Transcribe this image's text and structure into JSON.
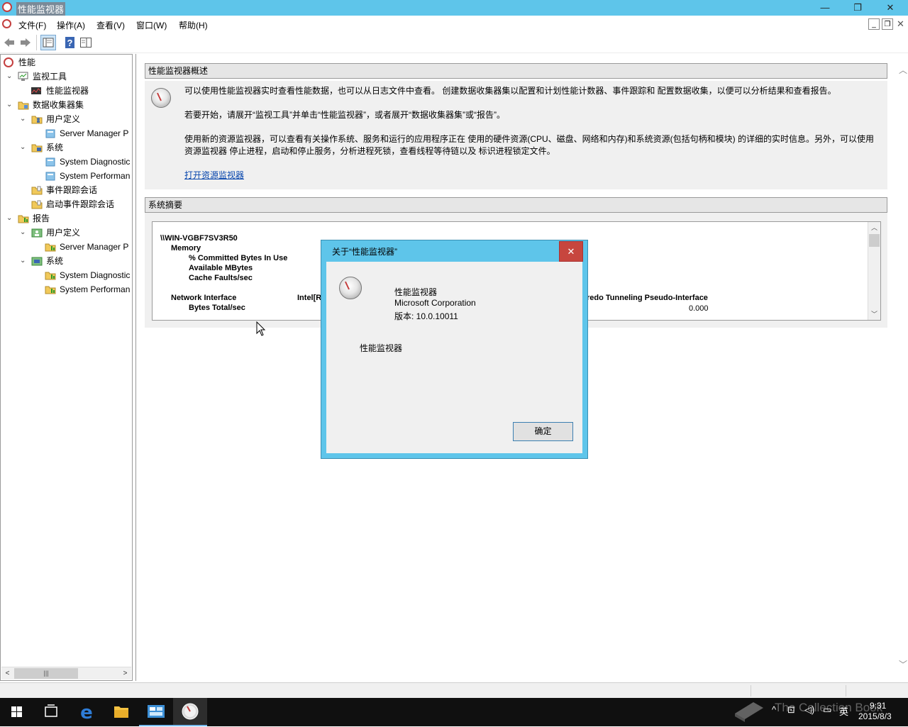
{
  "window": {
    "title": "性能监视器",
    "controls": {
      "minimize": "—",
      "restore": "❐",
      "close": "✕"
    }
  },
  "menu": {
    "items": [
      "文件(F)",
      "操作(A)",
      "查看(V)",
      "窗口(W)",
      "帮助(H)"
    ]
  },
  "tree": {
    "items": [
      {
        "label": "性能",
        "expander": "",
        "icon": "perfmon-root-icon"
      },
      {
        "label": "监视工具",
        "expander": "⌄",
        "icon": "monitor-tools-icon"
      },
      {
        "label": "性能监视器",
        "expander": "",
        "icon": "perf-chart-icon"
      },
      {
        "label": "数据收集器集",
        "expander": "⌄",
        "icon": "data-collector-icon"
      },
      {
        "label": "用户定义",
        "expander": "⌄",
        "icon": "user-defined-icon"
      },
      {
        "label": "Server Manager P",
        "expander": "",
        "icon": "collector-set-icon"
      },
      {
        "label": "系统",
        "expander": "⌄",
        "icon": "system-icon"
      },
      {
        "label": "System Diagnostic",
        "expander": "",
        "icon": "collector-set-icon"
      },
      {
        "label": "System Performan",
        "expander": "",
        "icon": "collector-set-icon"
      },
      {
        "label": "事件跟踪会话",
        "expander": "",
        "icon": "event-trace-icon"
      },
      {
        "label": "启动事件跟踪会话",
        "expander": "",
        "icon": "startup-trace-icon"
      },
      {
        "label": "报告",
        "expander": "⌄",
        "icon": "reports-icon"
      },
      {
        "label": "用户定义",
        "expander": "⌄",
        "icon": "report-user-icon"
      },
      {
        "label": "Server Manager P",
        "expander": "",
        "icon": "report-icon"
      },
      {
        "label": "系统",
        "expander": "⌄",
        "icon": "report-system-icon"
      },
      {
        "label": "System Diagnostic",
        "expander": "",
        "icon": "report-icon"
      },
      {
        "label": "System Performan",
        "expander": "",
        "icon": "report-icon"
      }
    ]
  },
  "overview": {
    "header": "性能监视器概述",
    "para1": "可以使用性能监视器实时查看性能数据，也可以从日志文件中查看。 创建数据收集器集以配置和计划性能计数器、事件跟踪和 配置数据收集，以便可以分析结果和查看报告。",
    "para2": "若要开始，请展开“监视工具”并单击“性能监视器”，或者展开“数据收集器集”或“报告”。",
    "para3a": "使用新的资源监视器，可以查看有关操作系统、服务和运行的应用程序正在 使用的硬件资源(CPU、磁盘、网络和内存)和系统资源(包括句柄和模块) 的详细的实时信息。另外，可以使用",
    "para3b": "资源监视器 停止进程，启动和停止服务，分析进程死锁，查看线程等待链以及 标识进程锁定文件。",
    "link": "打开资源监视器"
  },
  "summary": {
    "header": "系统摘要",
    "host": "\\\\WIN-VGBF7SV3R50",
    "memory": "Memory",
    "counter1": "% Committed Bytes In Use",
    "counter2": "Available MBytes",
    "counter3": "Cache Faults/sec",
    "network": "Network Interface",
    "intel": "Intel[R",
    "teredo": "redo Tunneling Pseudo-Interface",
    "bytes_total": "Bytes Total/sec",
    "bytes_value": "0.000"
  },
  "dialog": {
    "title": "关于“性能监视器”",
    "close": "✕",
    "product": "性能监视器",
    "company": "Microsoft Corporation",
    "version": "版本: 10.0.10011",
    "description": "性能监视器",
    "ok": "确定"
  },
  "taskbar": {
    "time": "9:31",
    "date": "2015/8/3",
    "ime": "英",
    "watermark": "The Collection Book"
  }
}
